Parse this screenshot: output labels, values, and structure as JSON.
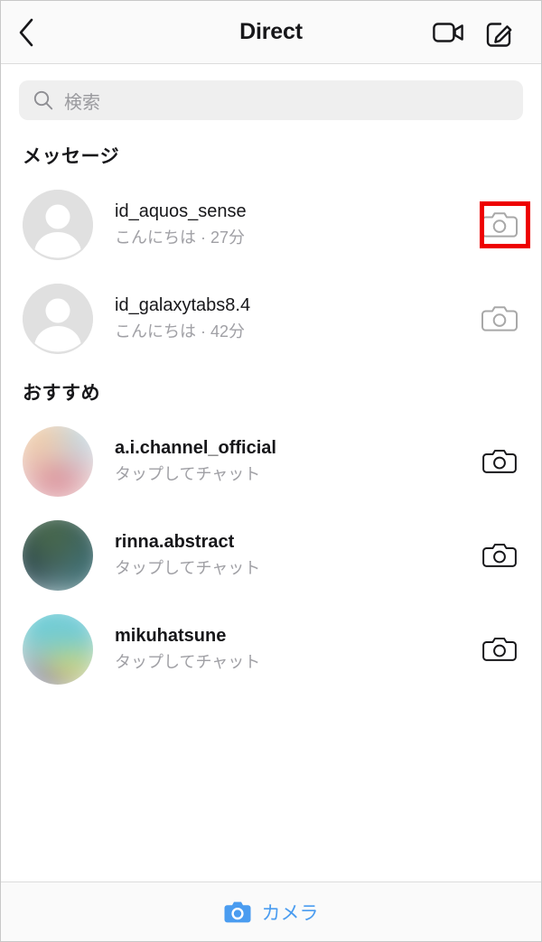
{
  "header": {
    "title": "Direct",
    "back_icon": "chevron-left-icon",
    "video_icon": "video-camera-icon",
    "compose_icon": "compose-pencil-icon"
  },
  "search": {
    "icon": "search-icon",
    "placeholder": "検索",
    "value": ""
  },
  "sections": [
    {
      "key": "messages",
      "title": "メッセージ",
      "rows": [
        {
          "username": "id_aquos_sense",
          "subtitle": "こんにちは · 27分",
          "avatar": "default-person-avatar",
          "camera_icon": "camera-icon",
          "camera_color": "#a8a8a8",
          "highlighted": true
        },
        {
          "username": "id_galaxytabs8.4",
          "subtitle": "こんにちは · 42分",
          "avatar": "default-person-avatar",
          "camera_icon": "camera-icon",
          "camera_color": "#a8a8a8",
          "highlighted": false
        }
      ]
    },
    {
      "key": "suggested",
      "title": "おすすめ",
      "rows": [
        {
          "username": "a.i.channel_official",
          "subtitle": "タップしてチャット",
          "avatar": "blurred-photo-avatar",
          "avatar_colors": [
            "#e8c2a8",
            "#d98a9a",
            "#f0d6d0",
            "#bcd8e8"
          ],
          "camera_icon": "camera-icon",
          "camera_color": "#17171a",
          "highlighted": false
        },
        {
          "username": "rinna.abstract",
          "subtitle": "タップしてチャット",
          "avatar": "blurred-photo-avatar",
          "avatar_colors": [
            "#3d6b63",
            "#2a4a52",
            "#546b3a",
            "#7fa8b0"
          ],
          "camera_icon": "camera-icon",
          "camera_color": "#17171a",
          "highlighted": false
        },
        {
          "username": "mikuhatsune",
          "subtitle": "タップしてチャット",
          "avatar": "blurred-photo-avatar",
          "avatar_colors": [
            "#5bc8d8",
            "#e8e05a",
            "#8a86b8",
            "#cfe0c0"
          ],
          "camera_icon": "camera-icon",
          "camera_color": "#17171a",
          "highlighted": false
        }
      ]
    }
  ],
  "bottom_bar": {
    "icon": "camera-filled-icon",
    "label": "カメラ",
    "accent": "#4a9cf0"
  },
  "annotation": {
    "highlight_color": "#ee0000"
  }
}
